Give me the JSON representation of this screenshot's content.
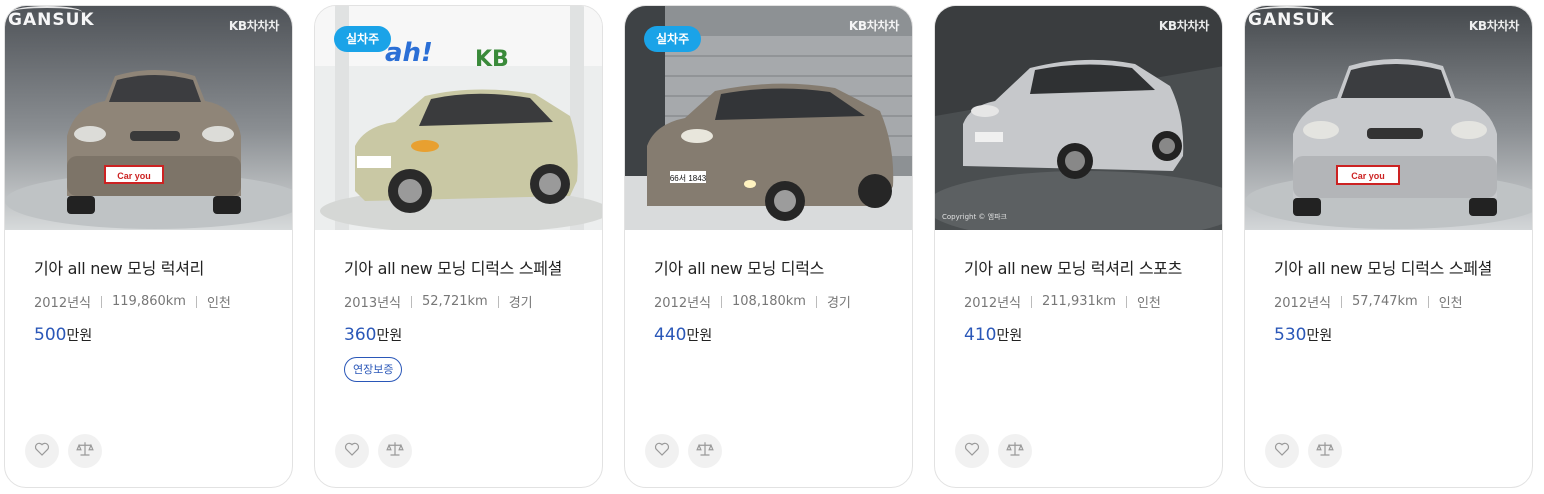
{
  "cards": [
    {
      "title": "기아 all new 모닝 럭셔리",
      "year": "2012년식",
      "mileage": "119,860km",
      "region": "인천",
      "price": "500",
      "price_unit": "만원",
      "badge": "",
      "tag": "",
      "watermark_left": "GANSUK",
      "watermark_right": "KB차차차",
      "photo": {
        "bg_top": "#55595f",
        "bg_bottom": "#cfd2d4",
        "car": "#8f8578",
        "plate": "Car you"
      }
    },
    {
      "title": "기아 all new 모닝 디럭스 스페셜",
      "year": "2013년식",
      "mileage": "52,721km",
      "region": "경기",
      "price": "360",
      "price_unit": "만원",
      "badge": "실차주",
      "tag": "연장보증",
      "watermark_left": "",
      "watermark_right": "",
      "photo": {
        "bg_top": "#eef0f0",
        "bg_bottom": "#e4e6e4",
        "car": "#c9c8a4",
        "plate": ""
      }
    },
    {
      "title": "기아 all new 모닝 디럭스",
      "year": "2012년식",
      "mileage": "108,180km",
      "region": "경기",
      "price": "440",
      "price_unit": "만원",
      "badge": "실차주",
      "tag": "",
      "watermark_left": "",
      "watermark_right": "KB차차차",
      "photo": {
        "bg_top": "#7a7d80",
        "bg_bottom": "#d8dadb",
        "car": "#857c70",
        "plate": "66서 1843"
      }
    },
    {
      "title": "기아 all new 모닝 럭셔리 스포츠",
      "year": "2012년식",
      "mileage": "211,931km",
      "region": "인천",
      "price": "410",
      "price_unit": "만원",
      "badge": "",
      "tag": "",
      "watermark_left": "",
      "watermark_right": "KB차차차",
      "photo": {
        "bg_top": "#3b3f41",
        "bg_bottom": "#565a5b",
        "car": "#c6c8cb",
        "plate": ""
      }
    },
    {
      "title": "기아 all new 모닝 디럭스 스페셜",
      "year": "2012년식",
      "mileage": "57,747km",
      "region": "인천",
      "price": "530",
      "price_unit": "만원",
      "badge": "",
      "tag": "",
      "watermark_left": "GANSUK",
      "watermark_right": "KB차차차",
      "photo": {
        "bg_top": "#4e5256",
        "bg_bottom": "#c8cbcd",
        "car": "#c7c9cc",
        "plate": "Car you"
      }
    }
  ],
  "icons": {
    "favorite": "heart-icon",
    "compare": "scale-icon"
  },
  "colors": {
    "accent": "#2a57b8",
    "badge": "#1aa3e8"
  }
}
